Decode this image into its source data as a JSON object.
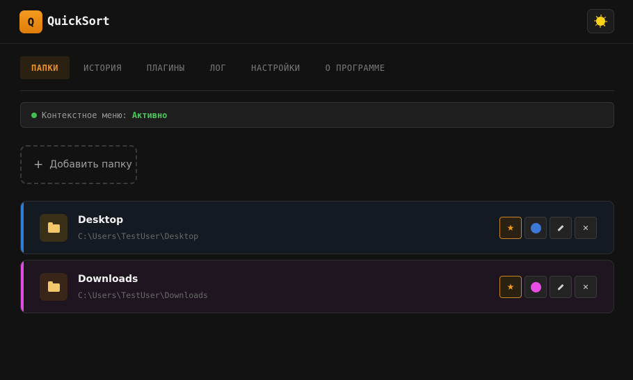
{
  "app": {
    "logo_letter": "Q",
    "title": "QuickSort"
  },
  "header": {
    "theme_icon": "sun-icon"
  },
  "tabs": [
    {
      "label": "ПАПКИ",
      "active": true
    },
    {
      "label": "ИСТОРИЯ",
      "active": false
    },
    {
      "label": "ПЛАГИНЫ",
      "active": false
    },
    {
      "label": "ЛОГ",
      "active": false
    },
    {
      "label": "НАСТРОЙКИ",
      "active": false
    },
    {
      "label": "О ПРОГРАММЕ",
      "active": false
    }
  ],
  "status": {
    "label": "Контекстное меню:",
    "value": "Активно",
    "color": "#3fbf4f"
  },
  "add_folder": {
    "plus": "+",
    "label": "Добавить папку"
  },
  "folders": [
    {
      "name": "Desktop",
      "path": "C:\\Users\\TestUser\\Desktop",
      "color": "#3b78d8",
      "stripe": "#2f7fd6",
      "background": "#141a22",
      "icon_bg": "#3a3018"
    },
    {
      "name": "Downloads",
      "path": "C:\\Users\\TestUser\\Downloads",
      "color": "#e84de6",
      "stripe": "#e24be0",
      "background": "#1e1520",
      "icon_bg": "#3a2619"
    }
  ],
  "actions": {
    "star": "★",
    "delete": "✕"
  },
  "colors": {
    "accent": "#e8902a",
    "background": "#121212"
  }
}
